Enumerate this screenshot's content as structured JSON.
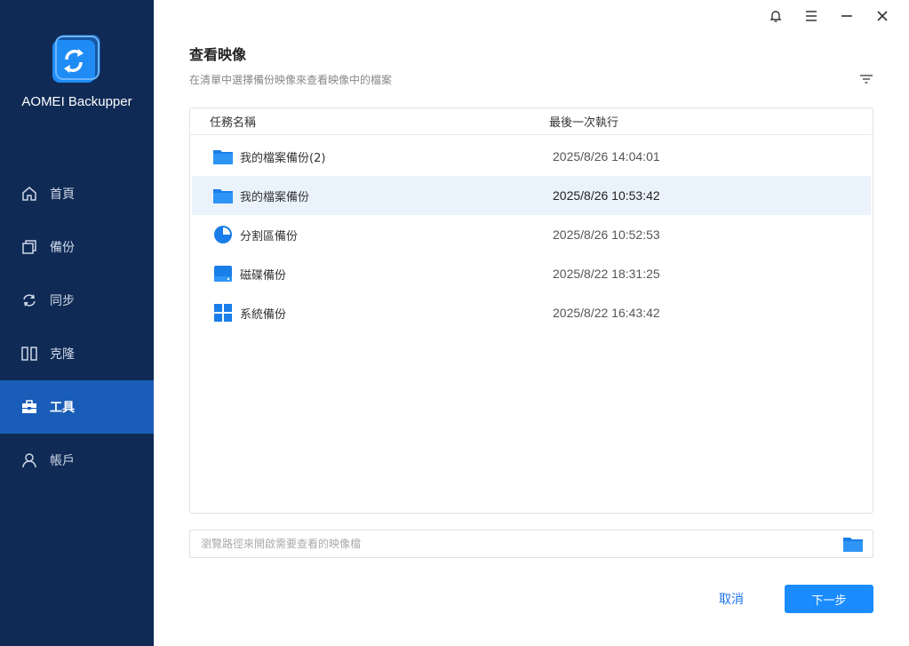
{
  "app": {
    "name": "AOMEI Backupper"
  },
  "sidebar": {
    "items": [
      {
        "label": "首頁",
        "icon": "home-icon"
      },
      {
        "label": "備份",
        "icon": "backup-icon"
      },
      {
        "label": "同步",
        "icon": "sync-icon"
      },
      {
        "label": "克隆",
        "icon": "clone-icon"
      },
      {
        "label": "工具",
        "icon": "tools-icon",
        "active": true
      },
      {
        "label": "帳戶",
        "icon": "account-icon"
      }
    ]
  },
  "titlebar": {
    "icons": [
      "bell-icon",
      "menu-icon",
      "minimize-icon",
      "close-icon"
    ]
  },
  "main": {
    "title": "查看映像",
    "subtitle": "在清單中選擇備份映像來查看映像中的檔案",
    "columns": {
      "name": "任務名稱",
      "last_run": "最後一次執行"
    },
    "tasks": [
      {
        "name": "我的檔案備份(2)",
        "time": "2025/8/26 14:04:01",
        "icon": "folder-icon"
      },
      {
        "name": "我的檔案備份",
        "time": "2025/8/26 10:53:42",
        "icon": "folder-icon",
        "selected": true
      },
      {
        "name": "分割區備份",
        "time": "2025/8/26 10:52:53",
        "icon": "partition-icon"
      },
      {
        "name": "磁碟備份",
        "time": "2025/8/22 18:31:25",
        "icon": "disk-icon"
      },
      {
        "name": "系統備份",
        "time": "2025/8/22 16:43:42",
        "icon": "windows-icon"
      }
    ],
    "path_input": {
      "placeholder": "瀏覽路徑來開啟需要查看的映像檔",
      "value": ""
    }
  },
  "footer": {
    "cancel_label": "取消",
    "next_label": "下一步"
  },
  "colors": {
    "sidebar_bg": "#0f2a55",
    "sidebar_active": "#1a5db8",
    "accent": "#1a8cff",
    "row_selected": "#eaf2fc"
  }
}
